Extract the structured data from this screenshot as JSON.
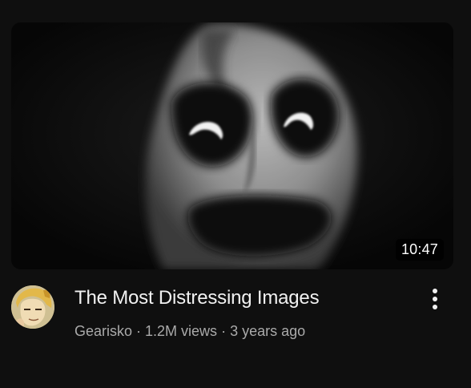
{
  "video": {
    "title": "The Most Distressing Images",
    "duration": "10:47",
    "channel": "Gearisko",
    "views": "1.2M views",
    "age": "3 years ago",
    "separator": "·",
    "thumbnail_icon": "creepy-face-thumbnail",
    "avatar_icon": "channel-avatar-icon",
    "menu_icon": "more-vert-icon"
  },
  "colors": {
    "background": "#0f0f0f",
    "title": "#f1f1f1",
    "subtitle": "#aaaaaa",
    "duration_bg": "#000000"
  }
}
